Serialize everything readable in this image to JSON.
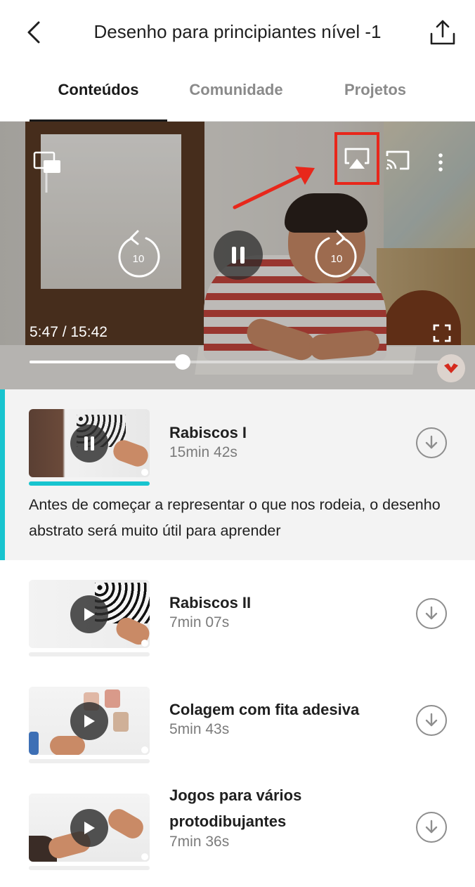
{
  "header": {
    "title": "Desenho para principiantes nível -1",
    "back_icon": "chevron-left-icon",
    "share_icon": "share-icon"
  },
  "tabs": [
    {
      "label": "Conteúdos",
      "active": true
    },
    {
      "label": "Comunidade",
      "active": false
    },
    {
      "label": "Projetos",
      "active": false
    }
  ],
  "player": {
    "time_label": "5:47 / 15:42",
    "progress": 0.37,
    "rewind_seconds": "10",
    "forward_seconds": "10",
    "highlight_color": "#e8271b",
    "icons": [
      "picture-in-picture-icon",
      "airplay-icon",
      "cast-icon",
      "more-vertical-icon",
      "rewind-10-icon",
      "pause-icon",
      "forward-10-icon",
      "fullscreen-icon"
    ]
  },
  "lessons": [
    {
      "title": "Rabiscos I",
      "duration": "15min 42s",
      "state": "playing",
      "progress": 1.0,
      "description": "Antes de começar a representar o que nos rodeia, o desenho abstrato será muito útil para aprender"
    },
    {
      "title": "Rabiscos II",
      "duration": "7min 07s",
      "state": "paused",
      "progress": 0
    },
    {
      "title": "Colagem com fita adesiva",
      "duration": "5min 43s",
      "state": "paused",
      "progress": 0
    },
    {
      "title": "Jogos para vários protodibujantes",
      "duration": "7min 36s",
      "state": "paused",
      "progress": 0
    }
  ],
  "colors": {
    "accent": "#17c4cf",
    "annotation": "#e8271b"
  }
}
